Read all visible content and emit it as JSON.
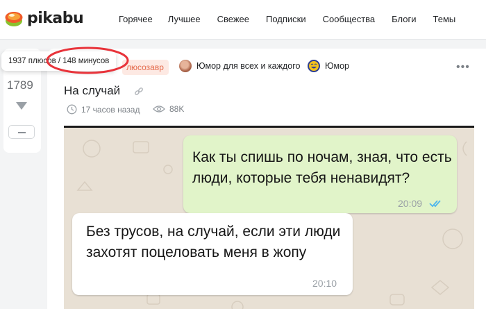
{
  "header": {
    "logo_text": "pikabu",
    "nav": [
      "Горячее",
      "Лучшее",
      "Свежее",
      "Подписки",
      "Сообщества",
      "Блоги",
      "Темы"
    ]
  },
  "vote": {
    "tooltip": "1937 плюсов / 148 минусов",
    "rating": "1789"
  },
  "post": {
    "tag": "люсозавр",
    "communities": [
      {
        "name": "Юмор для всех и каждого",
        "icon": "community-avatar-photo"
      },
      {
        "name": "Юмор",
        "icon": "laughing-emoji-icon"
      }
    ],
    "title": "На случай",
    "time": "17 часов назад",
    "views": "88K"
  },
  "chat": {
    "outgoing": {
      "text": "Как ты спишь по ночам, зная, что есть люди, которые тебя ненавидят?",
      "time": "20:09"
    },
    "incoming": {
      "text": "Без трусов, на случай, если эти люди захотят поцеловать меня в жопу",
      "time": "20:10"
    }
  },
  "colors": {
    "accent_red": "#e8333a",
    "pill_bg": "#fde9e3",
    "pill_text": "#e46b4d",
    "outgoing_bubble": "#e1f4c9",
    "chat_bg": "#e8e0d4",
    "read_ticks": "#4fb6ec"
  }
}
